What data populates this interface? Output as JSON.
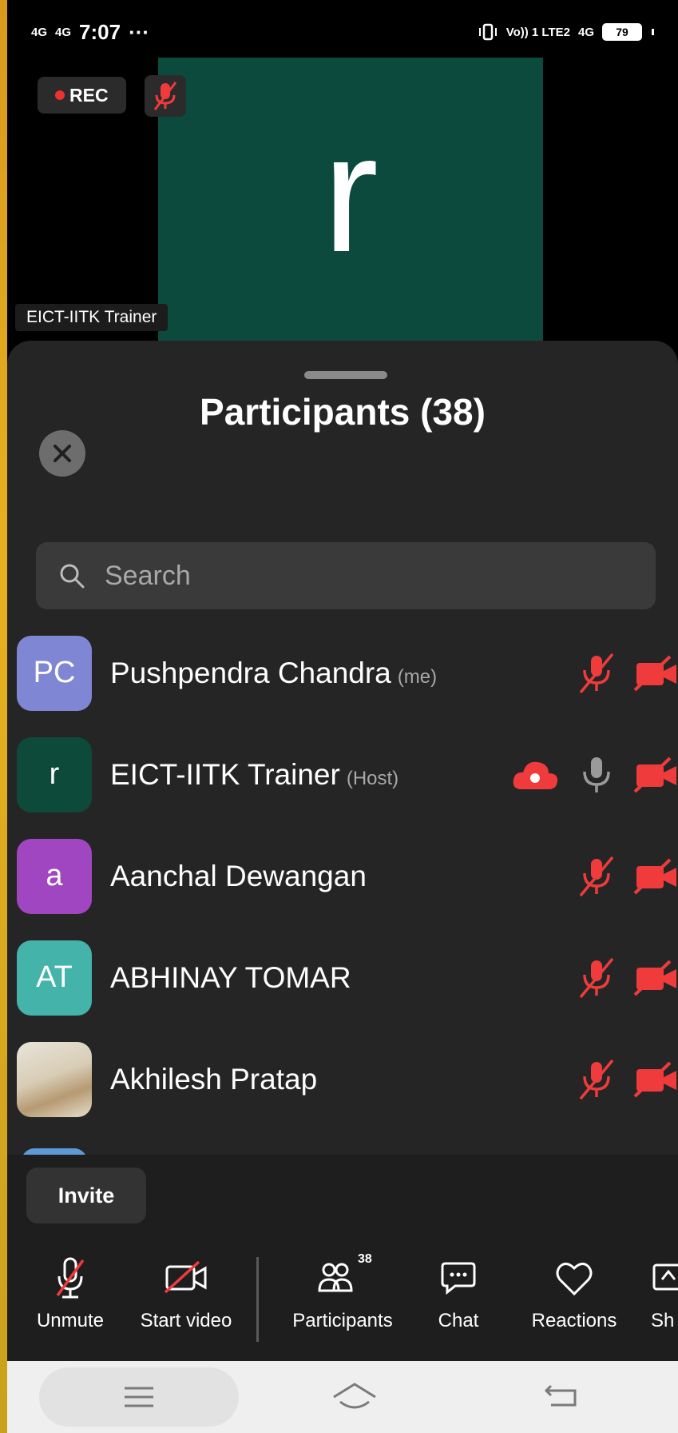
{
  "status_bar": {
    "signal_1": "4G",
    "signal_2": "4G",
    "time": "7:07",
    "more": "···",
    "network": "Vo)) 1 LTE2",
    "network_2": "4G",
    "battery": "79"
  },
  "video": {
    "rec_label": "REC",
    "tile_letter": "r",
    "tile_color": "#0b4a3c",
    "active_speaker_name": "EICT-IITK Trainer"
  },
  "panel": {
    "title": "Participants (38)",
    "search_placeholder": "Search",
    "participants": [
      {
        "initials": "PC",
        "name": "Pushpendra Chandra",
        "tag": "(me)",
        "avatar_color": "#7f86d3",
        "mic": "muted",
        "video": "off",
        "recording": false
      },
      {
        "initials": "r",
        "name": "EICT-IITK Trainer",
        "tag": "(Host)",
        "avatar_color": "#0d4a3a",
        "mic": "on",
        "video": "off",
        "recording": true
      },
      {
        "initials": "a",
        "name": "Aanchal Dewangan",
        "tag": "",
        "avatar_color": "#a046c0",
        "mic": "muted",
        "video": "off",
        "recording": false
      },
      {
        "initials": "AT",
        "name": "ABHINAY TOMAR",
        "tag": "",
        "avatar_color": "#44b3aa",
        "mic": "muted",
        "video": "off",
        "recording": false
      },
      {
        "initials": "",
        "name": "Akhilesh Pratap",
        "tag": "",
        "avatar_color": "photo",
        "mic": "muted",
        "video": "off",
        "recording": false
      }
    ],
    "invite_label": "Invite"
  },
  "toolbar": {
    "unmute_label": "Unmute",
    "start_video_label": "Start video",
    "participants_label": "Participants",
    "participants_count": "38",
    "chat_label": "Chat",
    "reactions_label": "Reactions",
    "share_label": "Sh"
  },
  "colors": {
    "muted_red": "#ef3b3b",
    "panel_bg": "#252525",
    "toolbar_bg": "#1e1e1e"
  }
}
